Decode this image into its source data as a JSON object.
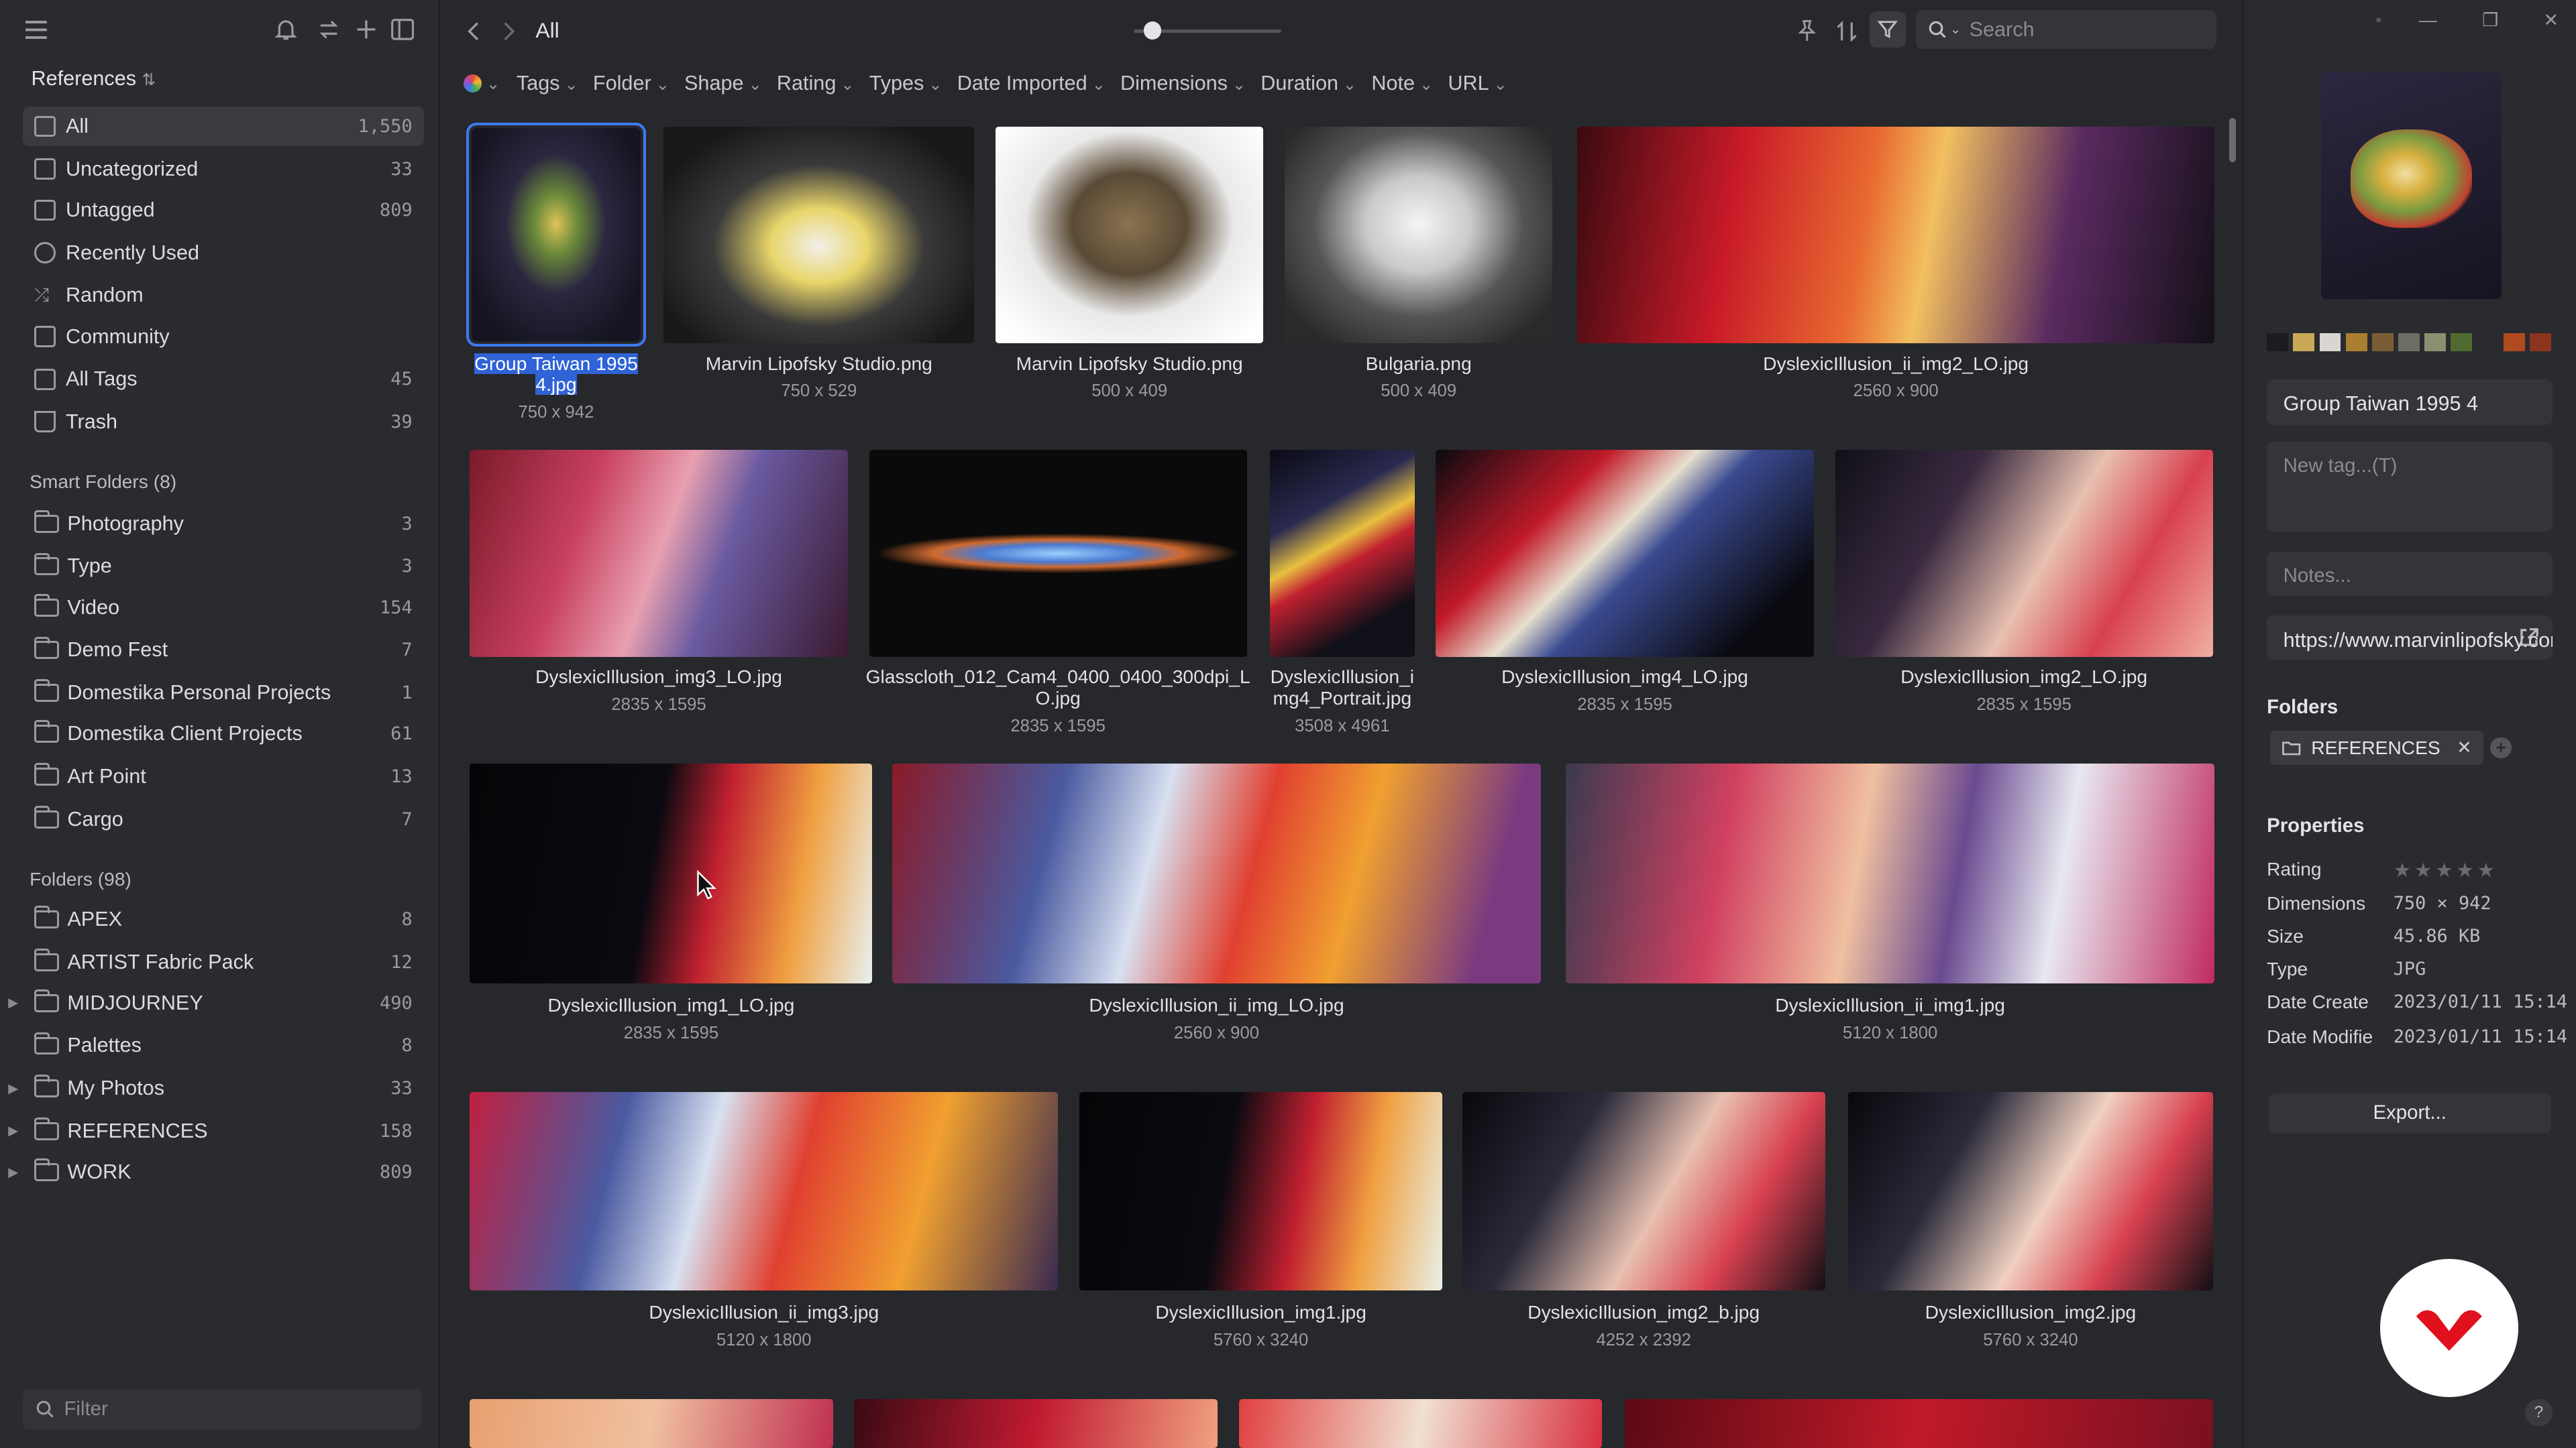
{
  "sidebar": {
    "library": "References",
    "nav": [
      {
        "label": "All",
        "count": "1,550"
      },
      {
        "label": "Uncategorized",
        "count": "33"
      },
      {
        "label": "Untagged",
        "count": "809"
      },
      {
        "label": "Recently Used",
        "count": ""
      },
      {
        "label": "Random",
        "count": ""
      },
      {
        "label": "Community",
        "count": ""
      },
      {
        "label": "All Tags",
        "count": "45"
      },
      {
        "label": "Trash",
        "count": "39"
      }
    ],
    "smart_title": "Smart Folders (8)",
    "smart": [
      {
        "label": "Photography",
        "count": "3"
      },
      {
        "label": "Type",
        "count": "3"
      },
      {
        "label": "Video",
        "count": "154"
      },
      {
        "label": "Demo Fest",
        "count": "7"
      },
      {
        "label": "Domestika Personal Projects",
        "count": "1"
      },
      {
        "label": "Domestika Client Projects",
        "count": "61"
      },
      {
        "label": "Art Point",
        "count": "13"
      },
      {
        "label": "Cargo",
        "count": "7"
      }
    ],
    "folders_title": "Folders (98)",
    "folders": [
      {
        "label": "APEX",
        "count": "8"
      },
      {
        "label": "ARTIST Fabric Pack",
        "count": "12"
      },
      {
        "label": "MIDJOURNEY",
        "count": "490"
      },
      {
        "label": "Palettes",
        "count": "8"
      },
      {
        "label": "My Photos",
        "count": "33"
      },
      {
        "label": "REFERENCES",
        "count": "158"
      },
      {
        "label": "WORK",
        "count": "809"
      }
    ],
    "filter_placeholder": "Filter"
  },
  "main": {
    "breadcrumb": "All",
    "search_placeholder": "Search",
    "filters": [
      "Tags",
      "Folder",
      "Shape",
      "Rating",
      "Types",
      "Date Imported",
      "Dimensions",
      "Duration",
      "Note",
      "URL"
    ],
    "items": [
      {
        "name": "Group Taiwan 1995 4.jpg",
        "name1": "Group Taiwan 1995",
        "name2": "4.jpg",
        "dim": "750 x 942"
      },
      {
        "name": "Marvin Lipofsky Studio.png",
        "dim": "750 x 529"
      },
      {
        "name": "Marvin Lipofsky Studio.png",
        "dim": "500 x 409"
      },
      {
        "name": "Bulgaria.png",
        "dim": "500 x 409"
      },
      {
        "name": "DyslexicIllusion_ii_img2_LO.jpg",
        "dim": "2560 x 900"
      },
      {
        "name": "DyslexicIllusion_img3_LO.jpg",
        "dim": "2835 x 1595"
      },
      {
        "name1": "Glasscloth_012_Cam4_0400_0400_300dpi_L",
        "name2": "O.jpg",
        "dim": "2835 x 1595"
      },
      {
        "name1": "DyslexicIllusion_i",
        "name2": "mg4_Portrait.jpg",
        "dim": "3508 x 4961"
      },
      {
        "name": "DyslexicIllusion_img4_LO.jpg",
        "dim": "2835 x 1595"
      },
      {
        "name": "DyslexicIllusion_img2_LO.jpg",
        "dim": "2835 x 1595"
      },
      {
        "name": "DyslexicIllusion_img1_LO.jpg",
        "dim": "2835 x 1595"
      },
      {
        "name": "DyslexicIllusion_ii_img_LO.jpg",
        "dim": "2560 x 900"
      },
      {
        "name": "DyslexicIllusion_ii_img1.jpg",
        "dim": "5120 x 1800"
      },
      {
        "name": "DyslexicIllusion_ii_img3.jpg",
        "dim": "5120 x 1800"
      },
      {
        "name": "DyslexicIllusion_img1.jpg",
        "dim": "5760 x 3240"
      },
      {
        "name": "DyslexicIllusion_img2_b.jpg",
        "dim": "4252 x 2392"
      },
      {
        "name": "DyslexicIllusion_img2.jpg",
        "dim": "5760 x 3240"
      }
    ]
  },
  "inspector": {
    "title_value": "Group Taiwan 1995 4",
    "tag_placeholder": "New tag...(T)",
    "notes_placeholder": "Notes...",
    "url_value": "https://www.marvinlipofsky.com",
    "folders_header": "Folders",
    "folder_tag": "REFERENCES",
    "properties_header": "Properties",
    "props": [
      {
        "label": "Rating",
        "value": ""
      },
      {
        "label": "Dimensions",
        "value": "750 × 942"
      },
      {
        "label": "Size",
        "value": "45.86 KB"
      },
      {
        "label": "Type",
        "value": "JPG"
      },
      {
        "label": "Date Create",
        "value": "2023/01/11 15:14"
      },
      {
        "label": "Date Modifie",
        "value": "2023/01/11 15:14"
      }
    ],
    "rating": 0,
    "export_label": "Export...",
    "help_label": "?",
    "palette": [
      "#1b1b22",
      "#c9a857",
      "#d9d6d2",
      "#a8802f",
      "#7b5d35",
      "#6c6e63",
      "#8b8f6f",
      "#4f6b2f",
      "#2a2b2f",
      "#b04a20",
      "#8b3520"
    ]
  },
  "colors": {
    "accent": "#3b7bf0",
    "logo": "#e0101c"
  }
}
